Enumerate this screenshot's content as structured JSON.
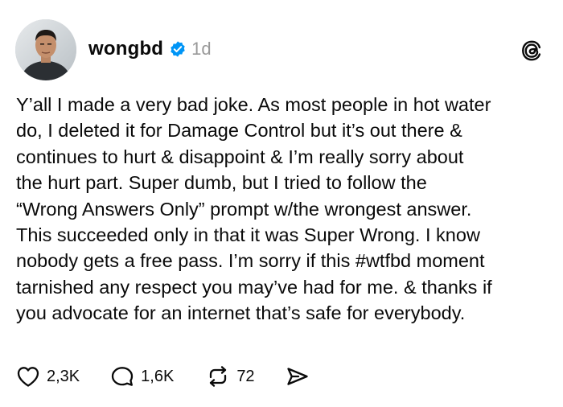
{
  "post": {
    "author": {
      "username": "wongbd",
      "verified": true,
      "time": "1d"
    },
    "body_lines": [
      "Y’all I made a very bad joke. As most people in hot water",
      "do, I deleted it for Damage Control but it’s out there &",
      "continues to hurt & disappoint & I’m really sorry about",
      "the hurt part. Super dumb, but I tried to follow the",
      "“Wrong Answers Only” prompt w/the wrongest answer.",
      "This succeeded only in that it was Super Wrong. I know",
      "nobody gets a free pass. I’m sorry if this #wtfbd moment",
      "tarnished any respect you may’ve had for me. & thanks if",
      "you advocate for an internet that’s safe for everybody."
    ],
    "stats": {
      "likes": "2,3K",
      "replies": "1,6K",
      "reposts": "72"
    }
  },
  "icons": {
    "verified": "verified-badge-icon",
    "platform": "threads-logo-icon",
    "like": "heart-icon",
    "reply": "speech-bubble-icon",
    "repost": "repost-arrows-icon",
    "share": "send-icon"
  },
  "colors": {
    "text": "#0a0a0a",
    "muted": "#999999",
    "verified": "#0095f6",
    "background": "#ffffff"
  }
}
